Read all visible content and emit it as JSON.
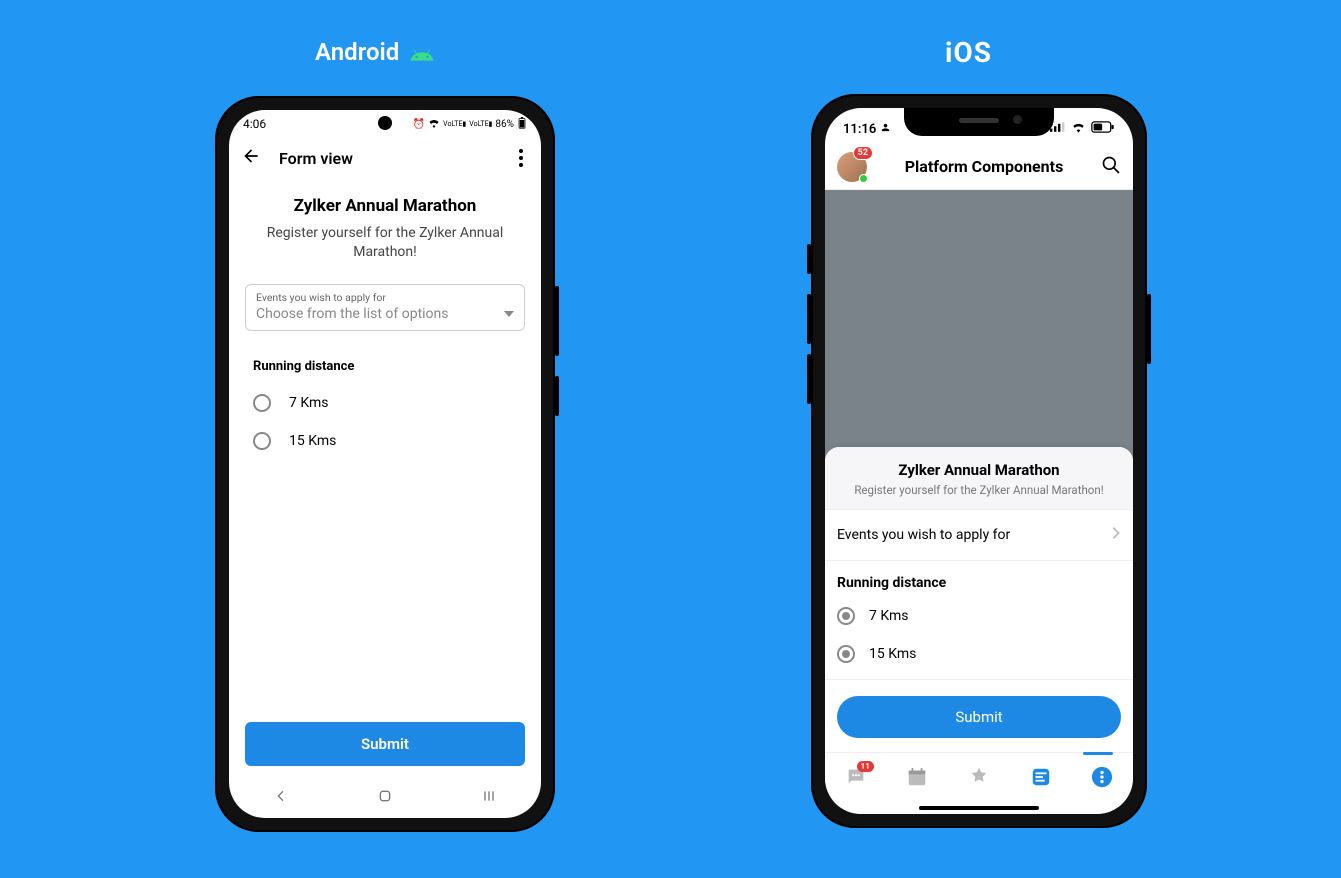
{
  "labels": {
    "android": "Android",
    "ios": "iOS"
  },
  "android": {
    "status": {
      "time": "4:06",
      "battery": "86%"
    },
    "appbar": {
      "title": "Form view"
    },
    "form": {
      "heading": "Zylker Annual Marathon",
      "subheading": "Register yourself for the Zylker Annual Marathon!",
      "events_label": "Events you wish to apply for",
      "events_placeholder": "Choose from the list of options",
      "running_label": "Running distance",
      "radios": [
        "7 Kms",
        "15 Kms"
      ],
      "submit": "Submit"
    }
  },
  "ios": {
    "status": {
      "time": "11:16"
    },
    "header": {
      "title": "Platform Components",
      "badge": "52"
    },
    "sheet": {
      "heading": "Zylker Annual Marathon",
      "subheading": "Register yourself for the Zylker Annual Marathon!",
      "events_label": "Events you wish to apply for",
      "running_label": "Running distance",
      "radios": [
        "7 Kms",
        "15 Kms"
      ],
      "submit": "Submit"
    },
    "tabbar": {
      "chat_badge": "11"
    }
  }
}
